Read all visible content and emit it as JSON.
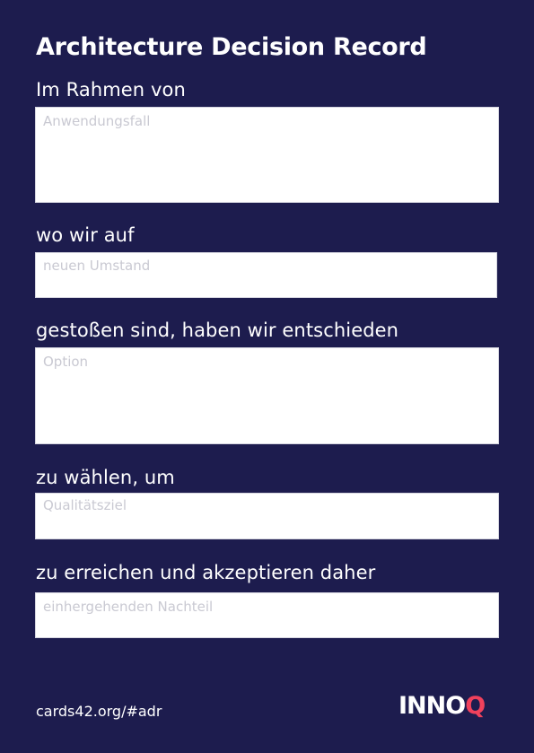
{
  "card": {
    "title": "Architecture Decision Record",
    "sections": [
      {
        "label": "Im Rahmen von",
        "placeholder": "Anwendungsfall"
      },
      {
        "label": "wo wir auf",
        "placeholder": "neuen Umstand"
      },
      {
        "label": "gestoßen sind, haben wir entschieden",
        "placeholder": "Option"
      },
      {
        "label": "zu wählen, um",
        "placeholder": "Qualitätsziel"
      },
      {
        "label": "zu erreichen und akzeptieren daher",
        "placeholder": "einhergehenden Nachteil"
      }
    ]
  },
  "footer": {
    "link_text": "cards42.org/#adr",
    "logo": {
      "text_main": "INNO",
      "text_accent": "Q",
      "accent_color": "#f0415c"
    }
  },
  "colors": {
    "background": "#1d1c4e",
    "text": "#ffffff",
    "field_background": "#ffffff",
    "placeholder": "#c9c9d2"
  }
}
